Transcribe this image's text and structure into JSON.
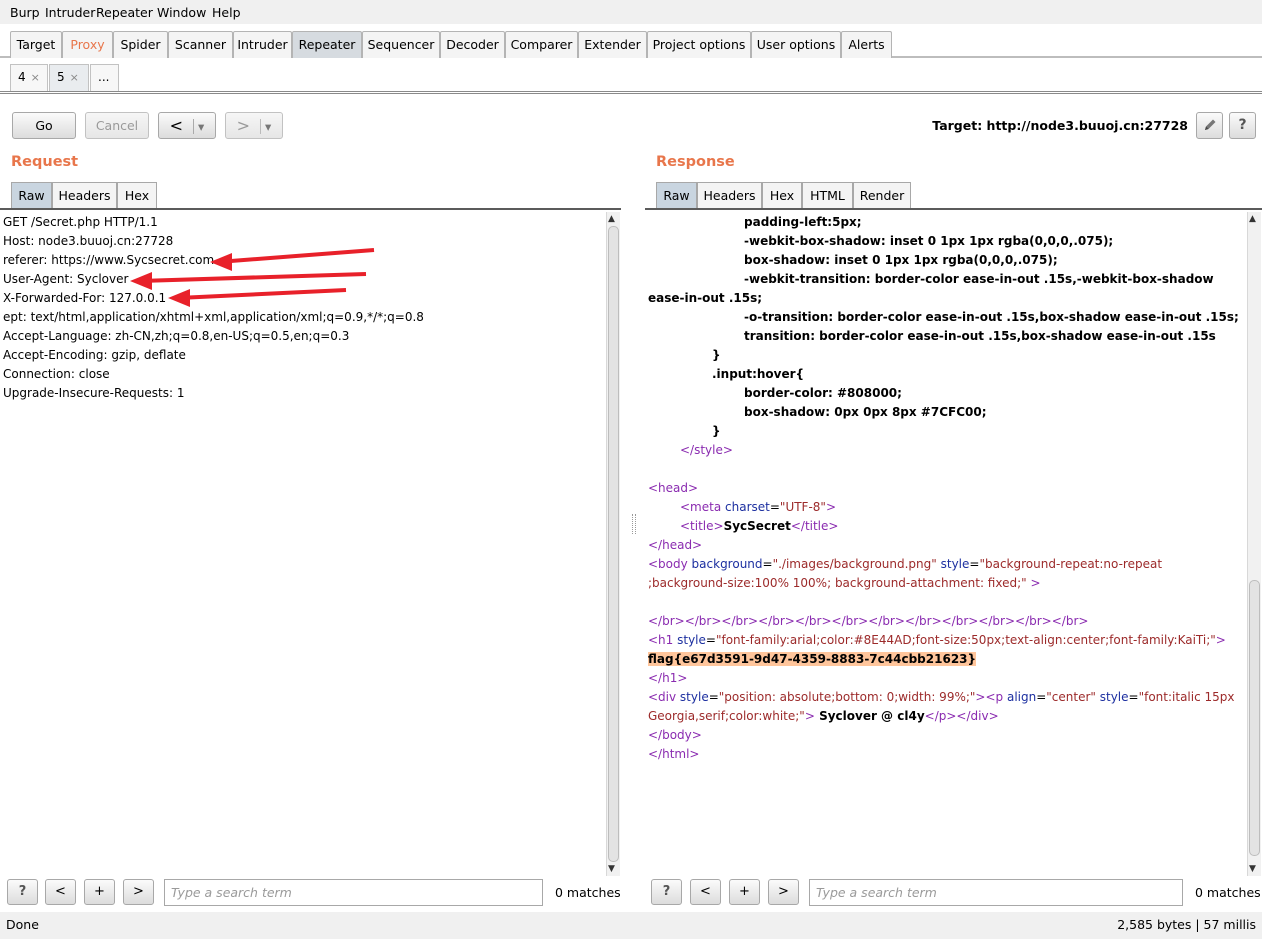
{
  "menu": [
    "Burp",
    "Intruder",
    "Repeater",
    "Window",
    "Help"
  ],
  "main_tabs": [
    "Target",
    "Proxy",
    "Spider",
    "Scanner",
    "Intruder",
    "Repeater",
    "Sequencer",
    "Decoder",
    "Comparer",
    "Extender",
    "Project options",
    "User options",
    "Alerts"
  ],
  "sub_tabs": [
    "4",
    "5",
    "..."
  ],
  "toolbar": {
    "go": "Go",
    "cancel": "Cancel",
    "back": "<",
    "forward": ">",
    "dropdown": "▾"
  },
  "target": "Target: http://node3.buuoj.cn:27728",
  "request": {
    "title": "Request",
    "tabs": [
      "Raw",
      "Headers",
      "Hex"
    ],
    "lines": [
      "GET /Secret.php HTTP/1.1",
      "Host: node3.buuoj.cn:27728",
      "referer: https://www.Sycsecret.com",
      "User-Agent: Syclover",
      "X-Forwarded-For: 127.0.0.1",
      "ept: text/html,application/xhtml+xml,application/xml;q=0.9,*/*;q=0.8",
      "Accept-Language: zh-CN,zh;q=0.8,en-US;q=0.5,en;q=0.3",
      "Accept-Encoding: gzip, deflate",
      "Connection: close",
      "Upgrade-Insecure-Requests: 1"
    ]
  },
  "response": {
    "title": "Response",
    "tabs": [
      "Raw",
      "Headers",
      "Hex",
      "HTML",
      "Render"
    ],
    "css_lines": [
      "padding-left:5px;",
      "-webkit-box-shadow: inset 0 1px 1px rgba(0,0,0,.075);",
      "box-shadow: inset 0 1px 1px rgba(0,0,0,.075);",
      "-webkit-transition: border-color ease-in-out .15s,-webkit-box-shadow",
      "ease-in-out .15s;",
      "-o-transition: border-color ease-in-out .15s,box-shadow ease-in-out .15s;",
      "transition: border-color ease-in-out .15s,box-shadow ease-in-out .15s",
      "}",
      ".input:hover{",
      "border-color: #808000;",
      "box-shadow: 0px 0px 8px #7CFC00;",
      "}"
    ],
    "style_close": "</style>",
    "head_open": "<head>",
    "meta": {
      "tag": "<meta",
      "attr": "charset",
      "eq": "=",
      "value": "\"UTF-8\"",
      "end": ">"
    },
    "title_line": {
      "open": "<title>",
      "text": "SycSecret",
      "close": "</title>"
    },
    "head_close": "</head>",
    "body_line1": {
      "open": "<body",
      "attr1": " background",
      "eq": "=",
      "val1": "\"./images/background.png\"",
      "attr2": " style",
      "val2": "\"background-repeat:no-repeat"
    },
    "body_line2": ";background-size:100% 100%; background-attachment: fixed;\"",
    "body_line2_end": " >",
    "br_line": "</br></br></br></br></br></br></br></br></br></br></br></br>",
    "h1_line": {
      "open": "<h1",
      "attr": " style",
      "eq": "=",
      "val": "\"font-family:arial;color:#8E44AD;font-size:50px;text-align:center;font-family:KaiTi;\"",
      "end": ">"
    },
    "flag": "flag{e67d3591-9d47-4359-8883-7c44cbb21623}",
    "h1_close": "</h1>",
    "div_line1": {
      "open": "<div",
      "attr1": " style",
      "eq": "=",
      "val1": "\"position: absolute;bottom: 0;width: 99%;\"",
      "close1": ">",
      "p_open": "<p",
      "attr2": " align",
      "val2": "\"center\"",
      "attr3": " style",
      "val3": "\"font:italic 15px"
    },
    "div_line2": {
      "val": "Georgia,serif;color:white;\"",
      "end": ">",
      "text": " Syclover @ cl4y",
      "p_close": "</p>",
      "div_close": "</div>"
    },
    "body_close": "</body>",
    "html_close": "</html>"
  },
  "search": {
    "help": "?",
    "prev": "<",
    "add": "+",
    "next": ">",
    "placeholder": "Type a search term",
    "matches": "0 matches"
  },
  "status": {
    "left": "Done",
    "right": "2,585 bytes | 57 millis"
  },
  "colors": {
    "accent": "#e8764b",
    "annotation_arrow": "#e8212a",
    "flag_highlight": "#ffc59b"
  }
}
